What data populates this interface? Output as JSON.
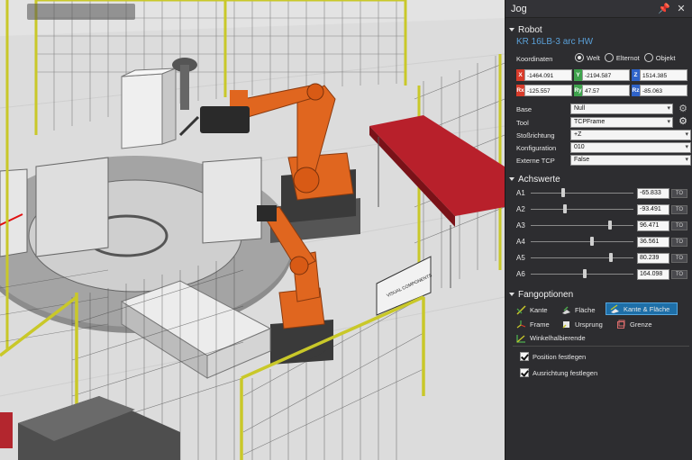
{
  "viewport": {
    "search_text": ""
  },
  "panel": {
    "title": "Jog",
    "pin_icon": "pin-icon",
    "close_icon": "close-icon"
  },
  "robot": {
    "section_label": "Robot",
    "name": "KR 16LB-3 arc HW",
    "coordinates_label": "Koordinaten",
    "coord_modes": [
      "Welt",
      "Elternot",
      "Objekt"
    ],
    "coord_selected": "Welt",
    "coords": [
      {
        "tag": "X",
        "value": "-1464.091",
        "color": "#d83b2a"
      },
      {
        "tag": "Y",
        "value": "-2194.587",
        "color": "#3fa34d"
      },
      {
        "tag": "Z",
        "value": "1514.385",
        "color": "#2f63c9"
      },
      {
        "tag": "Rx",
        "value": "-125.557",
        "color": "#d83b2a"
      },
      {
        "tag": "Ry",
        "value": "47.57",
        "color": "#3fa34d"
      },
      {
        "tag": "Rz",
        "value": "-85.063",
        "color": "#2f63c9"
      }
    ],
    "props": [
      {
        "label": "Base",
        "value": "Null"
      },
      {
        "label": "Tool",
        "value": "TCPFrame"
      },
      {
        "label": "Stoßrichtung",
        "value": "+Z"
      },
      {
        "label": "Konfiguration",
        "value": "010"
      },
      {
        "label": "Externe TCP",
        "value": "False"
      }
    ]
  },
  "axes": {
    "section_label": "Achswerte",
    "joints": [
      {
        "label": "A1",
        "value": "-65.833",
        "fraction": 0.32
      },
      {
        "label": "A2",
        "value": "-93.491",
        "fraction": 0.33
      },
      {
        "label": "A3",
        "value": "96.471",
        "fraction": 0.77
      },
      {
        "label": "A4",
        "value": "36.561",
        "fraction": 0.6
      },
      {
        "label": "A5",
        "value": "80.239",
        "fraction": 0.78
      },
      {
        "label": "A6",
        "value": "164.098",
        "fraction": 0.53
      }
    ],
    "to_label": "TO"
  },
  "snap": {
    "section_label": "Fangoptionen",
    "options": [
      "Kante",
      "Fläche",
      "Kante & Fläche",
      "Frame",
      "Ursprung",
      "Grenze",
      "Winkelhalbierende"
    ],
    "active": "Kante & Fläche"
  },
  "checks": [
    {
      "label": "Position festlegen",
      "checked": true
    },
    {
      "label": "Ausrichtung festlegen",
      "checked": true
    }
  ],
  "colors": {
    "robot_orange": "#e0661f",
    "accent_blue": "#1e6fa8",
    "fence_yellow": "#d4d235"
  },
  "sign_text": "VISUAL COMPONENTS"
}
